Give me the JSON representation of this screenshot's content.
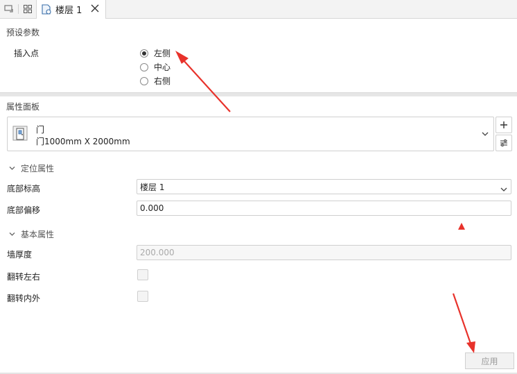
{
  "tabs": {
    "active_label": "楼层 1"
  },
  "preset": {
    "title": "预设参数",
    "insert_point_label": "插入点",
    "options": [
      "左侧",
      "中心",
      "右侧"
    ],
    "selected_index": 0
  },
  "properties": {
    "title": "属性面板",
    "family": "门",
    "type": "门1000mm X 2000mm"
  },
  "position_group": {
    "title": "定位属性",
    "base_level_label": "底部标高",
    "base_level_value": "楼层 1",
    "base_offset_label": "底部偏移",
    "base_offset_value": "0.000"
  },
  "basic_group": {
    "title": "基本属性",
    "wall_thickness_label": "墙厚度",
    "wall_thickness_value": "200.000",
    "flip_lr_label": "翻转左右",
    "flip_io_label": "翻转内外"
  },
  "apply_label": "应用",
  "colors": {
    "arrow_red": "#e8322b"
  }
}
